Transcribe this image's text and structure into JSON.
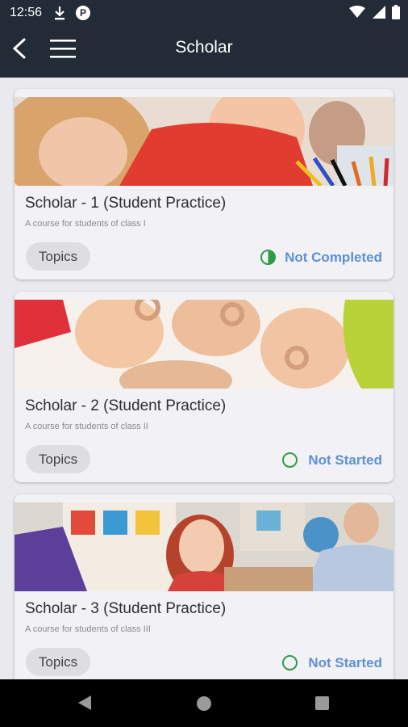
{
  "status_bar": {
    "time": "12:56",
    "app_icon_letter": "P"
  },
  "app_bar": {
    "title": "Scholar",
    "back_icon": "arrow-back-icon",
    "menu_icon": "hamburger-menu-icon"
  },
  "courses": [
    {
      "title": "Scholar - 1 (Student Practice)",
      "subtitle": "A course for students of class I",
      "topics_label": "Topics",
      "status": "Not Completed",
      "status_color": "#2e9c44"
    },
    {
      "title": "Scholar - 2 (Student Practice)",
      "subtitle": "A course for students of class II",
      "topics_label": "Topics",
      "status": "Not Started",
      "status_color": "#2e9c44"
    },
    {
      "title": "Scholar - 3 (Student Practice)",
      "subtitle": "A course for students of class III",
      "topics_label": "Topics",
      "status": "Not Started",
      "status_color": "#2e9c44"
    }
  ],
  "colors": {
    "app_bar": "#222b36",
    "status_text": "#5f8fd6",
    "background": "#e9e9ee"
  }
}
